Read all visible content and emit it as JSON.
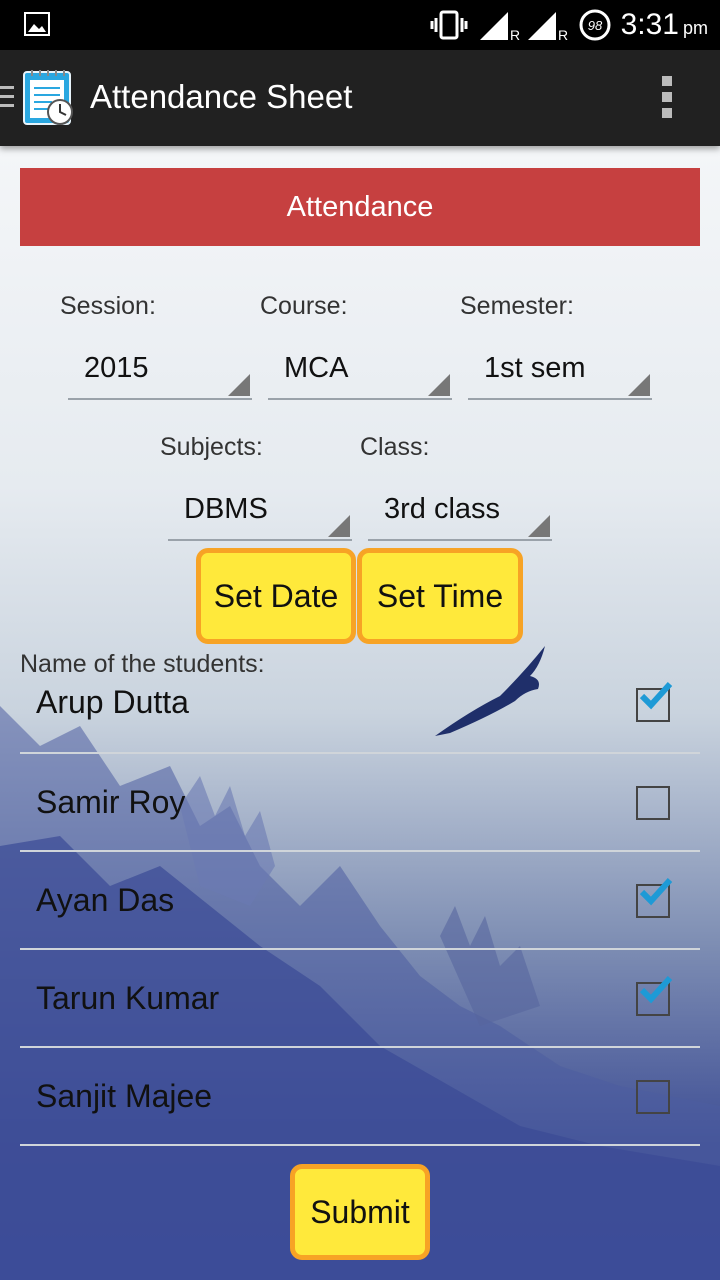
{
  "status_bar": {
    "time": "3:31",
    "ampm": "pm",
    "battery": "98"
  },
  "app_bar": {
    "title": "Attendance Sheet"
  },
  "header": {
    "title": "Attendance"
  },
  "session": {
    "label": "Session:",
    "value": "2015"
  },
  "course": {
    "label": "Course:",
    "value": "MCA"
  },
  "semester": {
    "label": "Semester:",
    "value": "1st sem"
  },
  "subjects": {
    "label": "Subjects:",
    "value": "DBMS"
  },
  "class_field": {
    "label": "Class:",
    "value": "3rd class"
  },
  "buttons": {
    "set_date": "Set Date",
    "set_time": "Set Time",
    "submit": "Submit"
  },
  "students": {
    "label": "Name of the students:",
    "items": [
      {
        "name": "Arup Dutta",
        "checked": true
      },
      {
        "name": "Samir Roy",
        "checked": false
      },
      {
        "name": "Ayan Das",
        "checked": true
      },
      {
        "name": "Tarun Kumar",
        "checked": true
      },
      {
        "name": "Sanjit Majee",
        "checked": false
      }
    ]
  },
  "colors": {
    "header_red": "#c64040",
    "button_yellow": "#ffe93b",
    "button_border": "#f7a325",
    "check_blue": "#1e9ad6"
  }
}
